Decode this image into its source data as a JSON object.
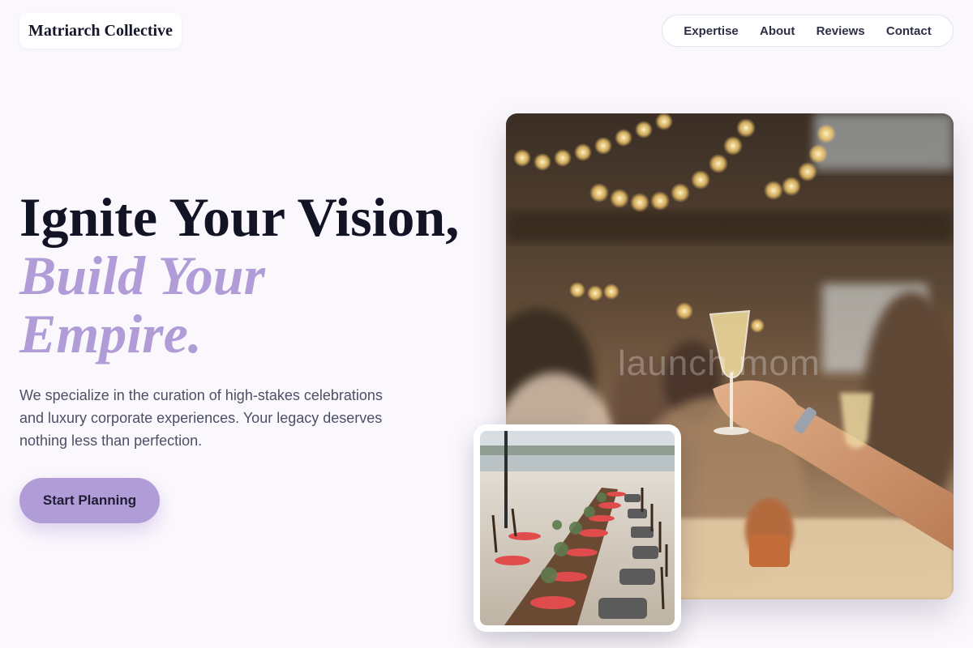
{
  "header": {
    "brand": "Matriarch Collective",
    "nav": [
      "Expertise",
      "About",
      "Reviews",
      "Contact"
    ]
  },
  "hero": {
    "headline_line1": "Ignite Your Vision,",
    "headline_accent_line1": "Build Your",
    "headline_accent_line2": "Empire.",
    "description": "We specialize in the curation of high-stakes celebrations and luxury corporate experiences. Your legacy deserves nothing less than perfection.",
    "cta_label": "Start Planning",
    "watermark": "launch.mom"
  },
  "colors": {
    "background": "#fbf8fd",
    "accent": "#b09cd6",
    "heading": "#121426",
    "body_text": "#4c5066"
  }
}
